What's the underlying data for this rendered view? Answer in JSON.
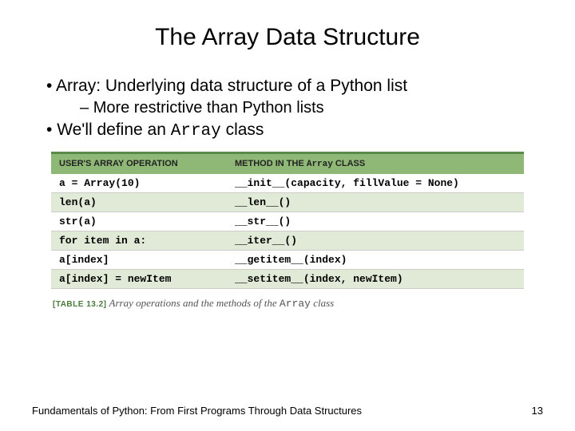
{
  "title": "The Array Data Structure",
  "bullets": {
    "b1a_pre": "Array: Underlying data structure of a Python list",
    "b2a": "More restrictive than Python lists",
    "b1b_pre": "We'll define an ",
    "b1b_mono": "Array",
    "b1b_post": " class"
  },
  "chart_data": {
    "type": "table",
    "headers": [
      "USER'S ARRAY OPERATION",
      "METHOD IN THE Array CLASS"
    ],
    "rows": [
      [
        "a = Array(10)",
        "__init__(capacity, fillValue = None)"
      ],
      [
        "len(a)",
        "__len__()"
      ],
      [
        "str(a)",
        "__str__()"
      ],
      [
        "for item in a:",
        "__iter__()"
      ],
      [
        "a[index]",
        "__getitem__(index)"
      ],
      [
        "a[index] = newItem",
        "__setitem__(index, newItem)"
      ]
    ]
  },
  "caption": {
    "tag": "[TABLE 13.2]",
    "text_pre": " Array operations and the methods of the ",
    "mono": "Array",
    "text_post": " class"
  },
  "footer": {
    "left": "Fundamentals of Python: From First Programs Through Data Structures",
    "right": "13"
  }
}
